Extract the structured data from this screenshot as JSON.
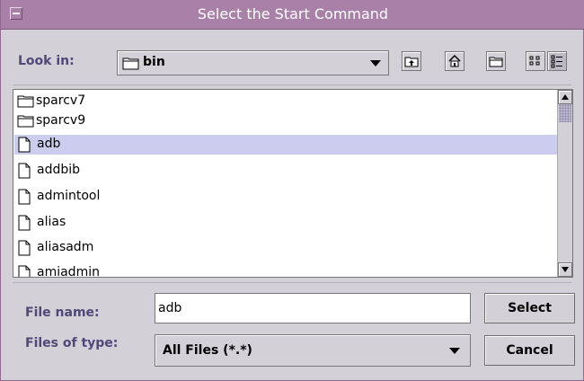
{
  "window": {
    "title": "Select the Start Command"
  },
  "lookin": {
    "label": "Look in:",
    "value": "bin"
  },
  "toolbar": {
    "up_icon": "up-folder-icon",
    "home_icon": "home-icon",
    "newfolder_icon": "new-folder-icon",
    "list_icon": "list-view-icon",
    "details_icon": "details-view-icon"
  },
  "files": [
    {
      "name": "sparcv7",
      "type": "folder",
      "selected": false
    },
    {
      "name": "sparcv9",
      "type": "folder",
      "selected": false
    },
    {
      "name": "adb",
      "type": "file",
      "selected": true
    },
    {
      "name": "addbib",
      "type": "file",
      "selected": false
    },
    {
      "name": "admintool",
      "type": "file",
      "selected": false
    },
    {
      "name": "alias",
      "type": "file",
      "selected": false
    },
    {
      "name": "aliasadm",
      "type": "file",
      "selected": false
    },
    {
      "name": "amiadmin",
      "type": "file",
      "selected": false
    }
  ],
  "filename": {
    "label": "File name:",
    "value": "adb"
  },
  "filetype": {
    "label": "Files of type:",
    "value": "All Files (*.*)"
  },
  "buttons": {
    "select": "Select",
    "cancel": "Cancel"
  },
  "colors": {
    "title_bar": "#a880a8",
    "selection": "#ccccee",
    "label": "#4f4878"
  }
}
